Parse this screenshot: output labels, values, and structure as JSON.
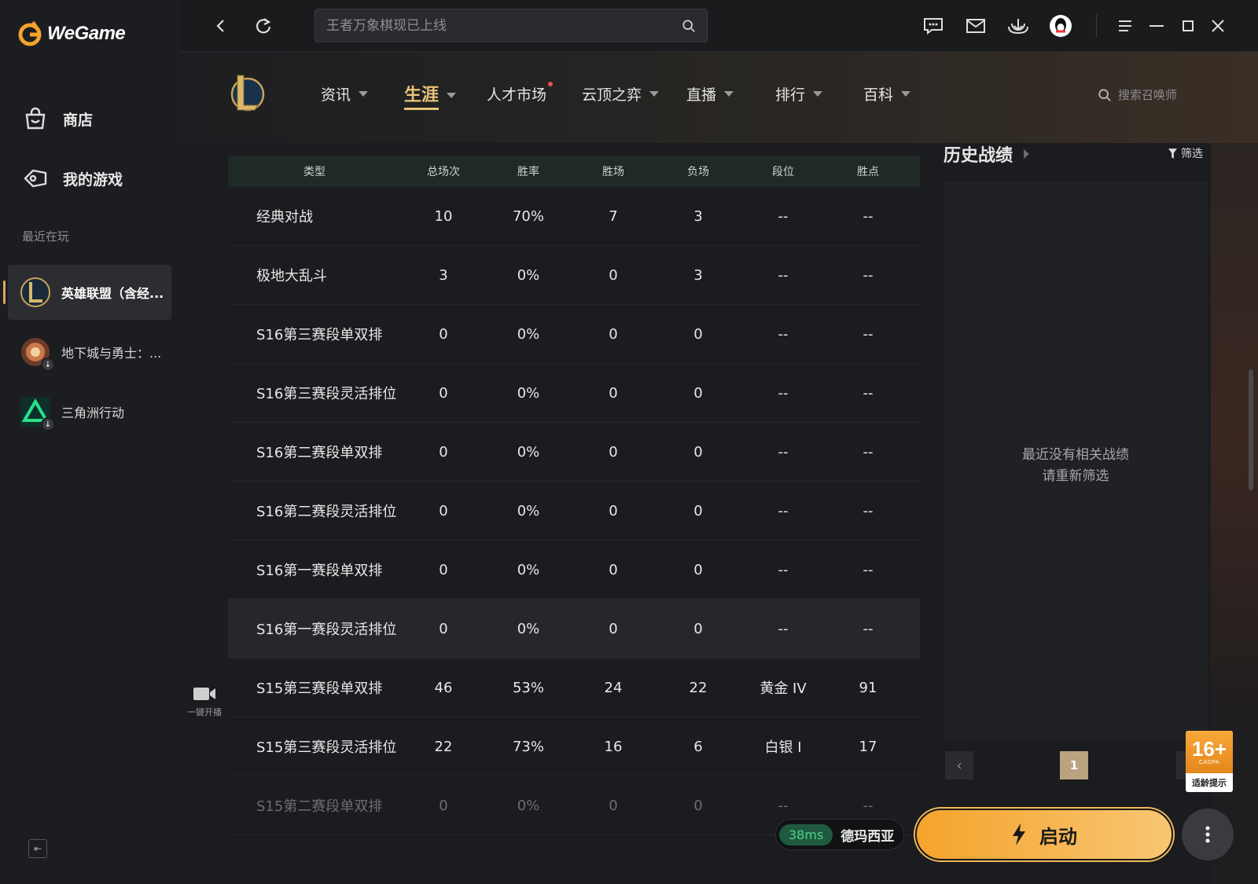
{
  "app": {
    "name": "WeGame"
  },
  "sidebar": {
    "nav": [
      {
        "label": "商店",
        "icon": "shop-bag-icon"
      },
      {
        "label": "我的游戏",
        "icon": "gamepad-icon"
      }
    ],
    "recent_label": "最近在玩",
    "games": [
      {
        "name": "英雄联盟（含经...",
        "icon": "lol-icon",
        "active": true
      },
      {
        "name": "地下城与勇士：...",
        "icon": "dnf-icon",
        "download": true
      },
      {
        "name": "三角洲行动",
        "icon": "delta-force-icon",
        "download": true
      }
    ],
    "live_label": "一键开播"
  },
  "topbar": {
    "search_placeholder": "王者万象棋现已上线"
  },
  "game_nav": {
    "tabs": [
      {
        "label": "资讯",
        "caret": true
      },
      {
        "label": "生涯",
        "caret": true,
        "active": true
      },
      {
        "label": "人才市场",
        "dot": true
      },
      {
        "label": "云顶之弈",
        "caret": true
      },
      {
        "label": "直播",
        "caret": true
      },
      {
        "label": "排行",
        "caret": true
      },
      {
        "label": "百科",
        "caret": true
      }
    ],
    "summoner_search_placeholder": "搜索召唤师"
  },
  "stats_table": {
    "headers": [
      "类型",
      "总场次",
      "胜率",
      "胜场",
      "负场",
      "段位",
      "胜点"
    ],
    "rows": [
      [
        "经典对战",
        "10",
        "70%",
        "7",
        "3",
        "--",
        "--"
      ],
      [
        "极地大乱斗",
        "3",
        "0%",
        "0",
        "3",
        "--",
        "--"
      ],
      [
        "S16第三赛段单双排",
        "0",
        "0%",
        "0",
        "0",
        "--",
        "--"
      ],
      [
        "S16第三赛段灵活排位",
        "0",
        "0%",
        "0",
        "0",
        "--",
        "--"
      ],
      [
        "S16第二赛段单双排",
        "0",
        "0%",
        "0",
        "0",
        "--",
        "--"
      ],
      [
        "S16第二赛段灵活排位",
        "0",
        "0%",
        "0",
        "0",
        "--",
        "--"
      ],
      [
        "S16第一赛段单双排",
        "0",
        "0%",
        "0",
        "0",
        "--",
        "--"
      ],
      [
        "S16第一赛段灵活排位",
        "0",
        "0%",
        "0",
        "0",
        "--",
        "--"
      ],
      [
        "S15第三赛段单双排",
        "46",
        "53%",
        "24",
        "22",
        "黄金 IV",
        "91"
      ],
      [
        "S15第三赛段灵活排位",
        "22",
        "73%",
        "16",
        "6",
        "白银 I",
        "17"
      ],
      [
        "S15第二赛段单双排",
        "0",
        "0%",
        "0",
        "0",
        "--",
        "--"
      ]
    ]
  },
  "history": {
    "title": "历史战绩",
    "filter_label": "筛选",
    "empty_line1": "最近没有相关战绩",
    "empty_line2": "请重新筛选",
    "current_page": "1"
  },
  "age_rating": {
    "number": "16+",
    "org": "CADPA",
    "label": "适龄提示"
  },
  "launch": {
    "ping": "38ms",
    "server": "德玛西亚",
    "start_label": "启动"
  },
  "colors": {
    "accent": "#e7c27a",
    "start": "#f5a32c",
    "ping": "#4fd18b"
  }
}
